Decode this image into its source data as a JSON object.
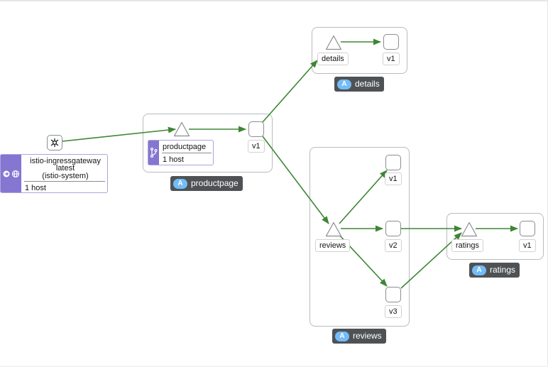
{
  "colors": {
    "edge": "#3e8635",
    "badge_bg": "#4f5255",
    "badge_pill": "#73bcf7",
    "workload_strip": "#8476d1",
    "node_border": "#8a8d90"
  },
  "icons": {
    "gateway_root": "root-gateway-icon",
    "gateway_in": "ingress-arrow-icon",
    "gateway_globe": "gateway-globe-icon",
    "branch": "virtual-service-branch-icon"
  },
  "badge_letter": "A",
  "gateway": {
    "name": "istio-ingressgateway",
    "version": "latest",
    "namespace": "(istio-system)",
    "hosts": "1 host"
  },
  "productpage": {
    "service_label": "productpage",
    "hosts": "1 host",
    "version": "v1",
    "app": "productpage"
  },
  "details": {
    "service_label": "details",
    "version": "v1",
    "app": "details"
  },
  "reviews": {
    "service_label": "reviews",
    "versions": [
      "v1",
      "v2",
      "v3"
    ],
    "app": "reviews"
  },
  "ratings": {
    "service_label": "ratings",
    "version": "v1",
    "app": "ratings"
  }
}
